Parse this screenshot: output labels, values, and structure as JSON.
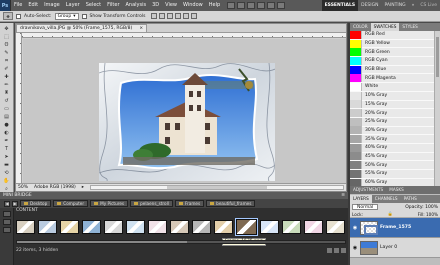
{
  "app": {
    "logo_text": "Ps",
    "menu": [
      "File",
      "Edit",
      "Image",
      "Layer",
      "Select",
      "Filter",
      "Analysis",
      "3D",
      "View",
      "Window",
      "Help"
    ],
    "workspaces": {
      "essentials": "ESSENTIALS",
      "design": "DESIGN",
      "painting": "PAINTING",
      "more": "»",
      "cslive": "CS Live"
    }
  },
  "options_bar": {
    "auto_select_label": "Auto-Select:",
    "auto_select_value": "Group",
    "show_transform_label": "Show Transform Controls"
  },
  "document": {
    "tab_title": "dravnikova_villa.JPG @ 50% (Frame_1575, RGB/8)",
    "close_glyph": "×",
    "zoom": "50%",
    "status_info": "Adobe RGB (1998)"
  },
  "panels": {
    "top_tabs": [
      "COLOR",
      "SWATCHES",
      "STYLES"
    ],
    "swatches": [
      {
        "name": "RGB Red",
        "color": "#ff0000"
      },
      {
        "name": "RGB Yellow",
        "color": "#ffff00"
      },
      {
        "name": "RGB Green",
        "color": "#00ff00"
      },
      {
        "name": "RGB Cyan",
        "color": "#00ffff"
      },
      {
        "name": "RGB Blue",
        "color": "#0000ff"
      },
      {
        "name": "RGB Magenta",
        "color": "#ff00ff"
      },
      {
        "name": "White",
        "color": "#ffffff"
      },
      {
        "name": "10% Gray",
        "color": "#e6e6e6"
      },
      {
        "name": "15% Gray",
        "color": "#d9d9d9"
      },
      {
        "name": "20% Gray",
        "color": "#cccccc"
      },
      {
        "name": "25% Gray",
        "color": "#bfbfbf"
      },
      {
        "name": "30% Gray",
        "color": "#b3b3b3"
      },
      {
        "name": "35% Gray",
        "color": "#a6a6a6"
      },
      {
        "name": "40% Gray",
        "color": "#999999"
      },
      {
        "name": "45% Gray",
        "color": "#8c8c8c"
      },
      {
        "name": "50% Gray",
        "color": "#808080"
      },
      {
        "name": "55% Gray",
        "color": "#737373"
      },
      {
        "name": "60% Gray",
        "color": "#666666"
      }
    ],
    "collapsed_tabs": [
      "ADJUSTMENTS",
      "MASKS"
    ],
    "layers_tabs": [
      "LAYERS",
      "CHANNELS",
      "PATHS"
    ],
    "blend_mode": "Normal",
    "opacity_label": "Opacity:",
    "opacity_value": "100%",
    "lock_label": "Lock:",
    "fill_label": "Fill:",
    "fill_value": "100%",
    "layers": [
      {
        "name": "Frame_1575",
        "active": true
      },
      {
        "name": "Layer 0",
        "active": false
      }
    ]
  },
  "bridge": {
    "title": "MINI BRIDGE",
    "menu_glyph": "≡",
    "breadcrumbs": [
      "Desktop",
      "Computer",
      "My Pictures",
      "pelaens_stroll",
      "Frames",
      "beautiful_frames"
    ],
    "content_label": "CONTENT",
    "tooltip": "Frame_1575.png",
    "status": "22 items, 3 hidden",
    "thumb_colors": [
      "#d7cfc0",
      "#b9cbe0",
      "#e6d4a6",
      "#8fb3d6",
      "#d8d8d8",
      "#cfe1f0",
      "#f0e1e7",
      "#d6c8b8",
      "#b7b7b7",
      "#e3cfaa",
      "#7f6a52",
      "#d7e4f6",
      "#c9dcbb",
      "#f1d7e5",
      "#e6e0cf"
    ]
  }
}
